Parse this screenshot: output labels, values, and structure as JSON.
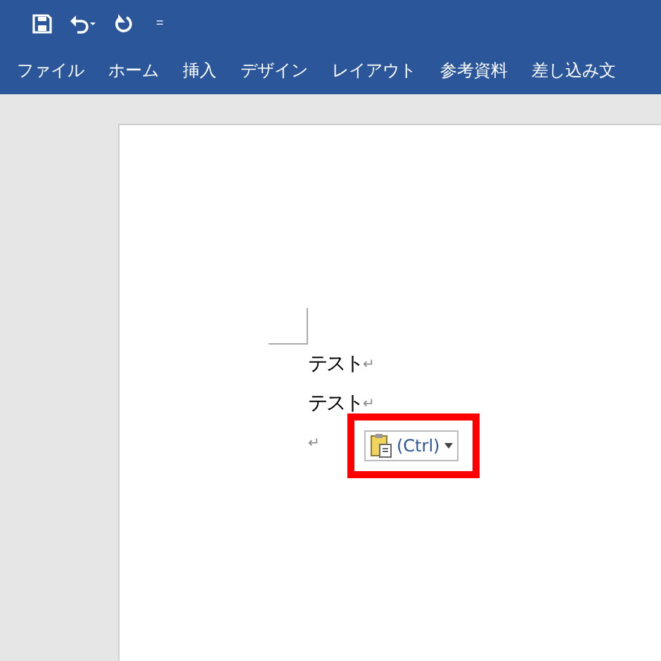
{
  "quick_access": {
    "customize": "="
  },
  "tabs": [
    {
      "label": "ファイル"
    },
    {
      "label": "ホーム"
    },
    {
      "label": "挿入"
    },
    {
      "label": "デザイン"
    },
    {
      "label": "レイアウト"
    },
    {
      "label": "参考資料"
    },
    {
      "label": "差し込み文"
    }
  ],
  "document": {
    "paragraphs": [
      {
        "text": "テスト",
        "mark": "↵"
      },
      {
        "text": "テスト",
        "mark": "↵"
      },
      {
        "mark": "↵"
      }
    ],
    "paste_options": {
      "label": "(Ctrl)"
    }
  }
}
